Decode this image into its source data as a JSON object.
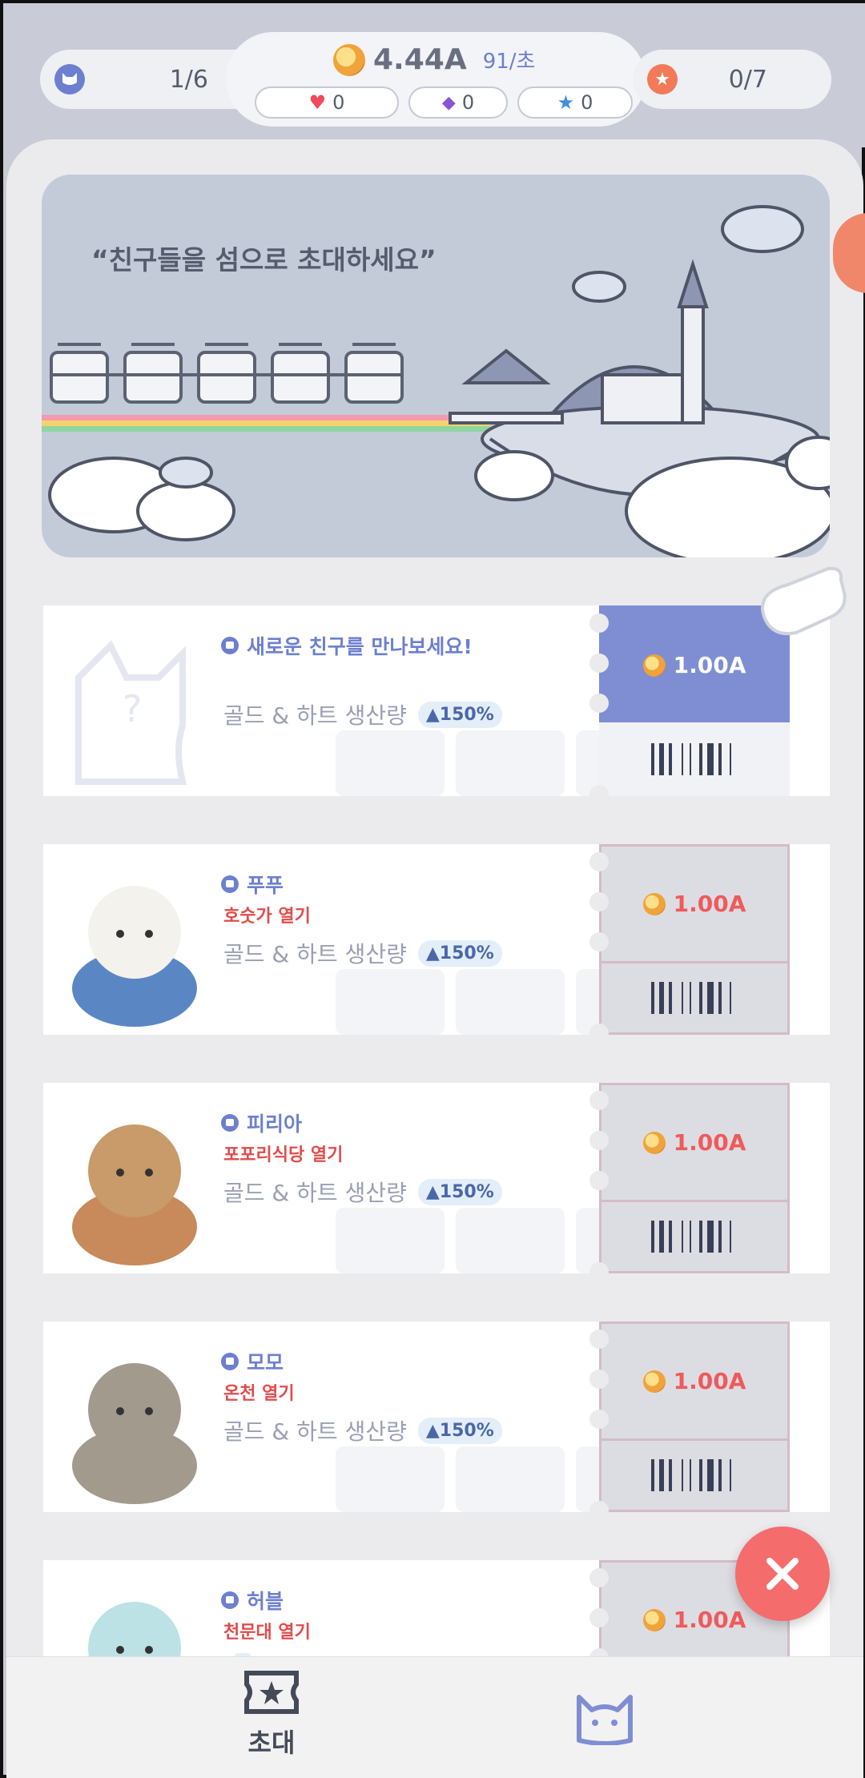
{
  "hud": {
    "friends_count": "1/6",
    "stars_count": "0/7",
    "gold_value": "4.44A",
    "gold_rate": "91/초",
    "hearts": "0",
    "gems": "0",
    "star_tickets": "0"
  },
  "banner": {
    "text": "“친구들을 섬으로 초대하세요”"
  },
  "cards": [
    {
      "name": "새로운 친구를 만나보세요!",
      "unlock": "",
      "production_label": "골드 & 하트 생산량",
      "boost": "▲150%",
      "price": "1.00A",
      "active": true
    },
    {
      "name": "푸푸",
      "unlock": "호숫가 열기",
      "production_label": "골드 & 하트 생산량",
      "boost": "▲150%",
      "price": "1.00A",
      "active": false
    },
    {
      "name": "피리아",
      "unlock": "포포리식당 열기",
      "production_label": "골드 & 하트 생산량",
      "boost": "▲150%",
      "price": "1.00A",
      "active": false
    },
    {
      "name": "모모",
      "unlock": "온천 열기",
      "production_label": "골드 & 하트 생산량",
      "boost": "▲150%",
      "price": "1.00A",
      "active": false
    },
    {
      "name": "허블",
      "unlock": "천문대 열기",
      "production_label": "",
      "boost": "",
      "price": "1.00A",
      "active": false
    }
  ],
  "nav": {
    "invite_label": "초대"
  },
  "colors": {
    "accent": "#6c7fd0",
    "price_red": "#ef5a5a",
    "close_button": "#f46c6c"
  },
  "icons": {
    "friends": "cat-icon",
    "stars": "star-icon",
    "gold": "coin-icon",
    "heart": "heart-icon",
    "gem": "gem-icon",
    "ticket": "ticket-icon",
    "close": "close-icon"
  }
}
